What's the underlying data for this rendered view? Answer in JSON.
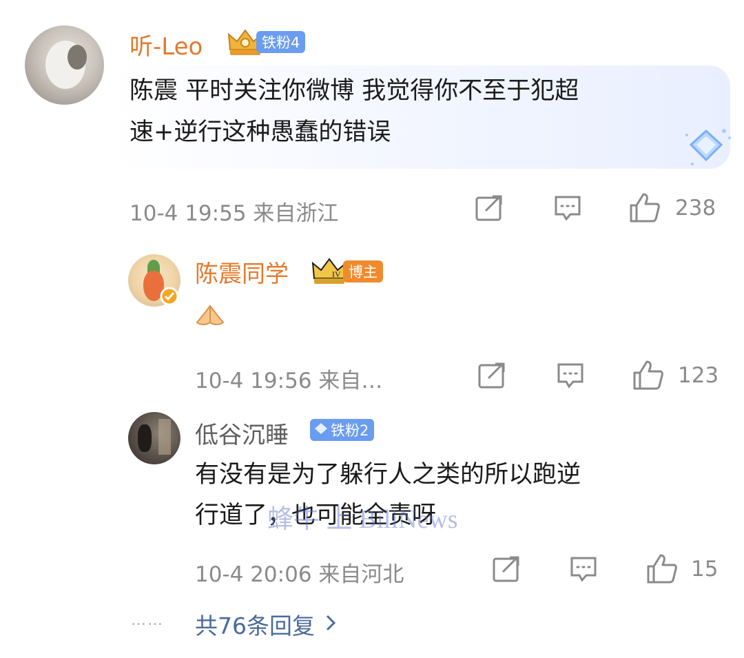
{
  "comments": [
    {
      "username": "听-Leo",
      "badge": "铁粉4",
      "text_lines": [
        "陈震 平时关注你微博 我觉得你不至于犯超",
        "速+逆行这种愚蠢的错误"
      ],
      "time": "10-4 19:55",
      "location": "来自浙江",
      "likes": "238"
    },
    {
      "username": "陈震同学",
      "badge": "博主",
      "time": "10-4 19:56",
      "location": "来自…",
      "likes": "123"
    },
    {
      "username": "低谷沉睡",
      "badge": "铁粉2",
      "text_lines": [
        "有没有是为了躲行人之类的所以跑逆",
        "行道了，也可能全责呀"
      ],
      "time": "10-4 20:06",
      "location": "来自河北",
      "likes": "15"
    }
  ],
  "more_dots": "……",
  "more_replies": "共76条回复",
  "watermark": "蜂牛 上 BiliNews",
  "colors": {
    "username_orange": "#e5792a",
    "username_blue": "#6b6b6b",
    "badge_blue": "#6a9cf0",
    "badge_orange": "#f08a2c",
    "meta_gray": "#8a8a8a",
    "link_blue": "#4a6a9a"
  }
}
